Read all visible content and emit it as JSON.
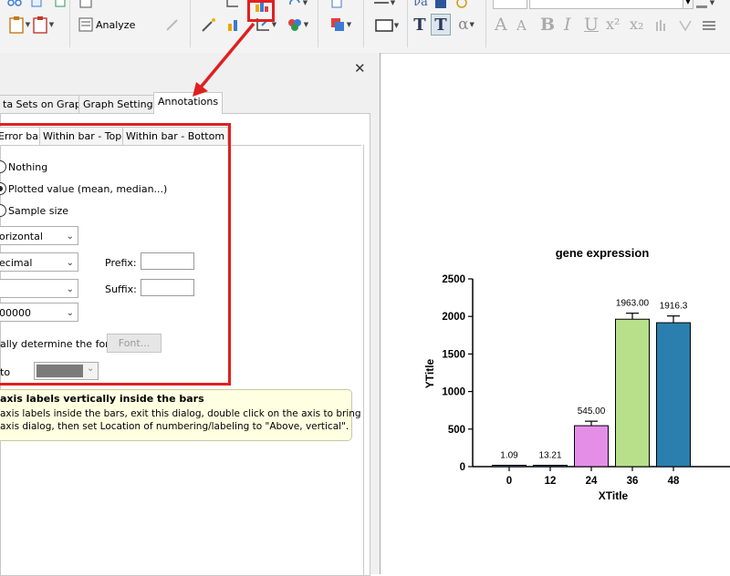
{
  "toolbar": {
    "analyze_label": "Analyze",
    "text_tools": [
      "T",
      "T",
      "α"
    ],
    "format_letters": [
      "A",
      "A",
      "B",
      "I",
      "U",
      "x²",
      "x₂"
    ]
  },
  "dialog": {
    "tabs": [
      "ta Sets on Graph",
      "Graph Settings",
      "Annotations"
    ],
    "subtabs": [
      "Error bar",
      "Within bar - Top",
      "Within bar - Bottom"
    ],
    "radios": [
      {
        "label": "Nothing",
        "checked": false
      },
      {
        "label": "Plotted value (mean, median...)",
        "checked": true
      },
      {
        "label": "Sample size",
        "checked": false
      }
    ],
    "orientation_value": "orizontal",
    "format_value": "ecimal",
    "digits_value": "",
    "number_value": "00000",
    "prefix_label": "Prefix:",
    "suffix_label": "Suffix:",
    "font_text": "ally determine the font",
    "font_button": "Font...",
    "color_label": "to",
    "hint_title": "axis labels vertically inside the bars",
    "hint_line1": "axis labels inside the bars, exit this dialog, double click on the axis to bring",
    "hint_line2": "axis dialog, then set Location of numbering/labeling to \"Above, vertical\"."
  },
  "chart_data": {
    "type": "bar",
    "title": "gene expression",
    "xlabel": "XTitle",
    "ylabel": "YTitle",
    "categories": [
      "0",
      "12",
      "24",
      "36",
      "48"
    ],
    "values": [
      1.09,
      13.21,
      545.0,
      1963.0,
      1916.3
    ],
    "value_labels": [
      "1.09",
      "13.21",
      "545.00",
      "1963.00",
      "1916.3"
    ],
    "errors": [
      0,
      0,
      60,
      80,
      90
    ],
    "colors": [
      "#4472c4",
      "#2e4fa0",
      "#e58ee8",
      "#b8e08a",
      "#2a7fae"
    ],
    "ylim": [
      0,
      2500
    ],
    "yticks": [
      "0",
      "500",
      "1000",
      "1500",
      "2000",
      "2500"
    ]
  }
}
